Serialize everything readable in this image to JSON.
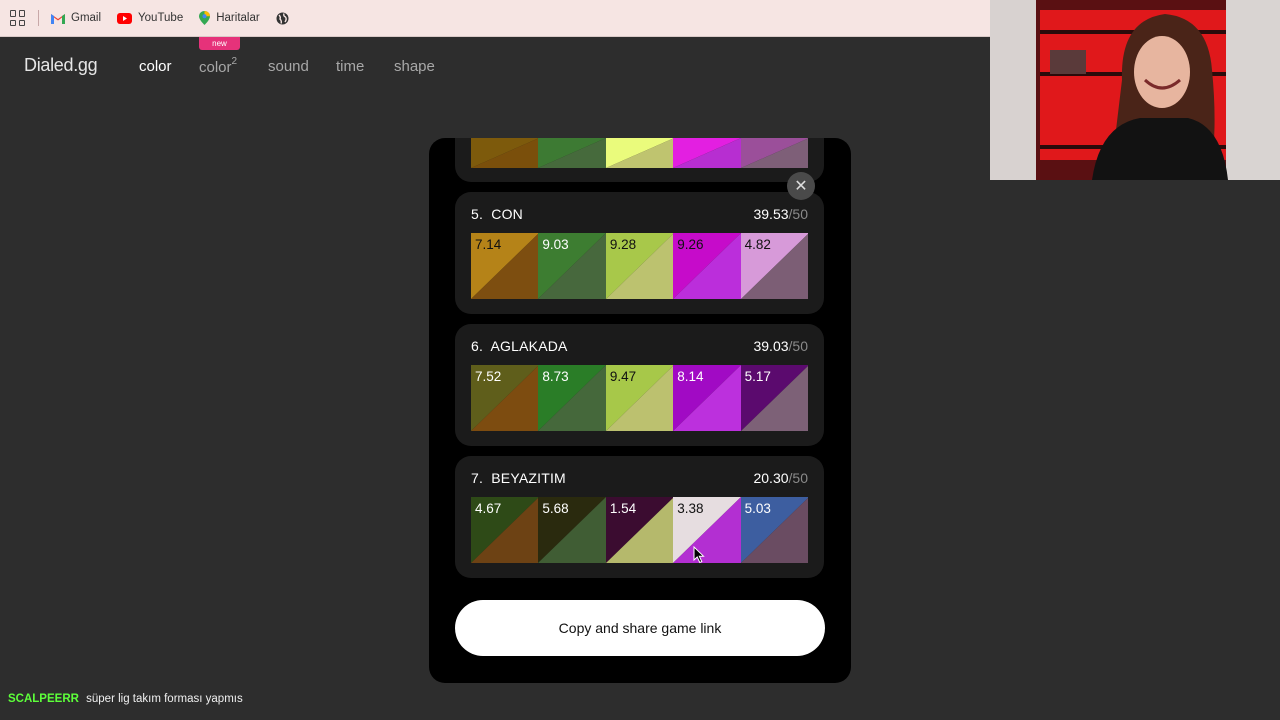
{
  "bookmarks": [
    {
      "label": "Gmail",
      "icon": "gmail-icon"
    },
    {
      "label": "YouTube",
      "icon": "youtube-icon"
    },
    {
      "label": "Haritalar",
      "icon": "maps-icon"
    }
  ],
  "site": {
    "logo": "Dialed.gg",
    "nav": {
      "color": "color",
      "color2": "color",
      "color2_sup": "2",
      "sound": "sound",
      "time": "time",
      "shape": "shape"
    },
    "new_badge": "new"
  },
  "partial_card": {
    "colors": [
      {
        "top": "#7d5a0c",
        "bottom": "#7a4f0b"
      },
      {
        "top": "#3d7a33",
        "bottom": "#466a3c"
      },
      {
        "top": "#eafb7c",
        "bottom": "#bfc46f"
      },
      {
        "top": "#e31fe1",
        "bottom": "#b72ed1"
      },
      {
        "top": "#9b4f9a",
        "bottom": "#7e5f78"
      }
    ]
  },
  "results": [
    {
      "rank": "5.",
      "name": "CON",
      "score": "39.53",
      "max": "/50",
      "tiles": [
        {
          "value": "7.14",
          "top": "#b58318",
          "bottom": "#7d4e10",
          "text": "dark"
        },
        {
          "value": "9.03",
          "top": "#3d7d31",
          "bottom": "#47683d",
          "text": "light"
        },
        {
          "value": "9.28",
          "top": "#a8c84a",
          "bottom": "#bcc26f",
          "text": "dark"
        },
        {
          "value": "9.26",
          "top": "#c60bca",
          "bottom": "#bb2edb",
          "text": "dark"
        },
        {
          "value": "4.82",
          "top": "#d79ad9",
          "bottom": "#7c5e75",
          "text": "dark"
        }
      ]
    },
    {
      "rank": "6.",
      "name": "AGLAKADA",
      "score": "39.03",
      "max": "/50",
      "tiles": [
        {
          "value": "7.52",
          "top": "#5f5e1b",
          "bottom": "#7d4c10",
          "text": "light"
        },
        {
          "value": "8.73",
          "top": "#2a7d27",
          "bottom": "#45683b",
          "text": "light"
        },
        {
          "value": "9.47",
          "top": "#a7c849",
          "bottom": "#bcc16f",
          "text": "dark"
        },
        {
          "value": "8.14",
          "top": "#a10ac4",
          "bottom": "#bc30dd",
          "text": "light"
        },
        {
          "value": "5.17",
          "top": "#5b0a6e",
          "bottom": "#7d6177",
          "text": "light"
        }
      ]
    },
    {
      "rank": "7.",
      "name": "BEYAZITIM",
      "score": "20.30",
      "max": "/50",
      "tiles": [
        {
          "value": "4.67",
          "top": "#2e4a17",
          "bottom": "#6d4214",
          "text": "light"
        },
        {
          "value": "5.68",
          "top": "#2a2a0e",
          "bottom": "#405d34",
          "text": "light"
        },
        {
          "value": "1.54",
          "top": "#3b0c30",
          "bottom": "#b5b96c",
          "text": "light"
        },
        {
          "value": "3.38",
          "top": "#e6dde0",
          "bottom": "#b32fd2",
          "text": "dark"
        },
        {
          "value": "5.03",
          "top": "#3d5ea0",
          "bottom": "#6a4c62",
          "text": "light"
        }
      ]
    }
  ],
  "close_icon": "close-icon",
  "share_button": "Copy and share game link",
  "chat": {
    "user": "SCALPEERR",
    "message": "süper lig takım forması yapmıs"
  }
}
